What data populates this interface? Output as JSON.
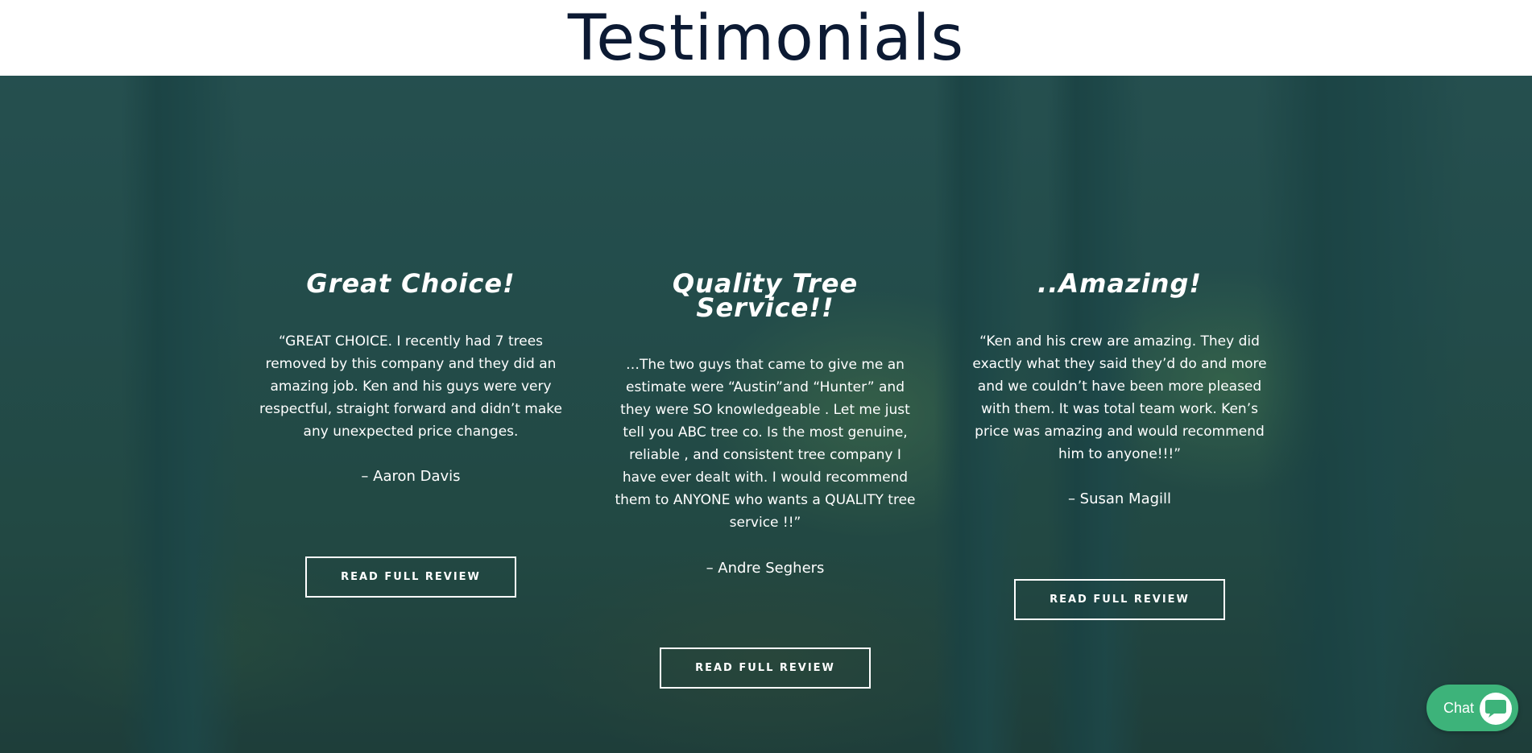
{
  "header": {
    "title": "Testimonials"
  },
  "testimonials": [
    {
      "title": "Great Choice!",
      "quote": "“GREAT CHOICE. I recently had 7 trees removed by this company and they did an amazing job. Ken and his guys were very respectful, straight forward and didn’t make any unexpected price changes.",
      "author": "–  Aaron Davis",
      "button_label": "READ FULL REVIEW"
    },
    {
      "title": "Quality Tree Service!!",
      "quote": "…The two guys that came to give me an estimate were “Austin”and “Hunter” and they were SO knowledgeable . Let me just tell you ABC tree co. Is the most genuine, reliable , and consistent tree company I have ever dealt with. I would recommend them to ANYONE who wants a QUALITY tree service !!”",
      "author": "–  Andre Seghers",
      "button_label": "READ FULL REVIEW"
    },
    {
      "title": "..Amazing!",
      "quote": "“Ken and his crew are amazing. They did exactly what they said they’d do and more and we couldn’t have been more pleased with them. It was total team work. Ken’s price was amazing and would recommend him to anyone!!!”",
      "author": "–  Susan Magill",
      "button_label": "READ FULL REVIEW"
    }
  ],
  "chat": {
    "label": "Chat",
    "icon": "chat-bubble-icon",
    "color": "#3db37a"
  },
  "colors": {
    "title": "#0c1a33",
    "overlay": "#2b5551",
    "text": "#ffffff"
  }
}
